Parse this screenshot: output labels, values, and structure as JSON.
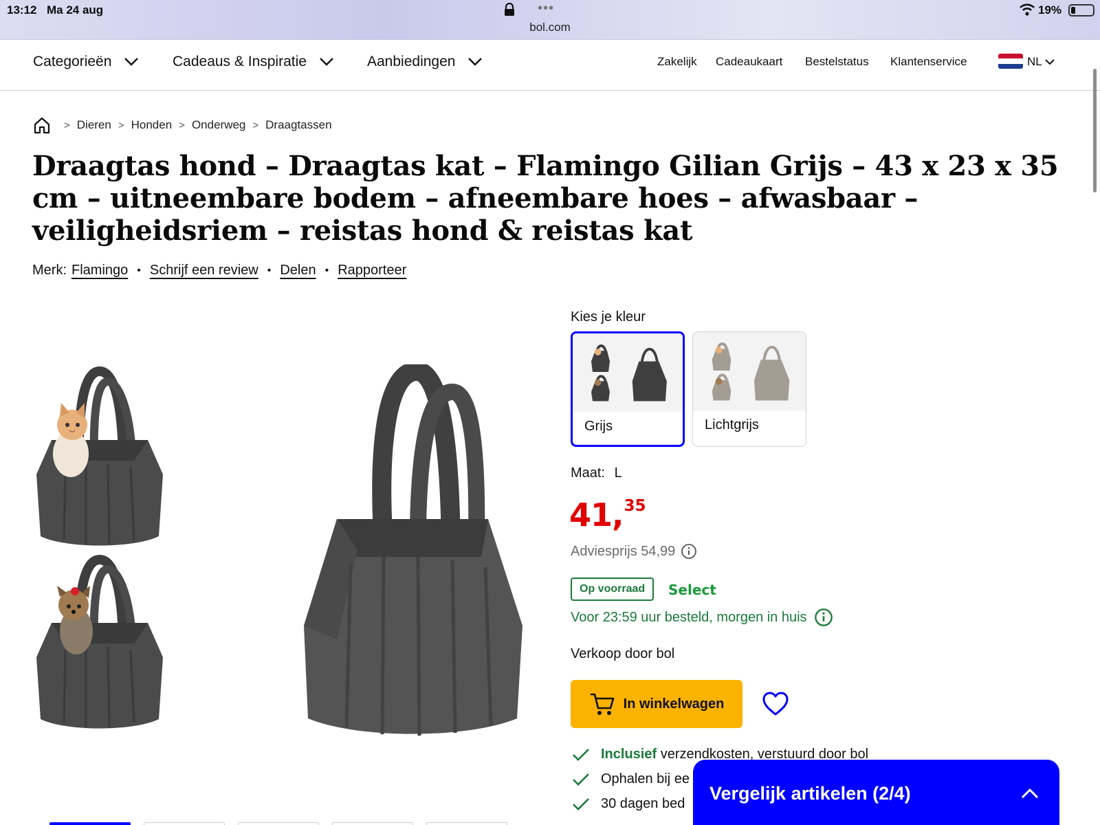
{
  "status_bar": {
    "time": "13:12",
    "date": "Ma 24 aug",
    "url": "bol.com",
    "menu_dots": "•••",
    "battery": "19%"
  },
  "nav": {
    "categories": "Categorieën",
    "gifts": "Cadeaus & Inspiratie",
    "deals": "Aanbiedingen",
    "business": "Zakelijk",
    "giftcard": "Cadeaukaart",
    "order_status": "Bestelstatus",
    "customer_service": "Klantenservice",
    "language": "NL"
  },
  "breadcrumb": [
    "Dieren",
    "Honden",
    "Onderweg",
    "Draagtassen"
  ],
  "product": {
    "title": "Draagtas hond – Draagtas kat – Flamingo Gilian Grijs – 43 x 23 x 35 cm – uitneembare bodem – afneembare hoes – afwasbaar – veiligheidsriem – reistas hond & reistas kat",
    "brand_label": "Merk:",
    "brand": "Flamingo",
    "write_review": "Schrijf een review",
    "share": "Delen",
    "report": "Rapporteer"
  },
  "color_picker": {
    "label": "Kies je kleur",
    "options": [
      {
        "label": "Grijs",
        "selected": true
      },
      {
        "label": "Lichtgrijs",
        "selected": false
      }
    ]
  },
  "size": {
    "label": "Maat:",
    "value": "L"
  },
  "price": {
    "whole": "41,",
    "cents": "35",
    "advice": "Adviesprijs 54,99",
    "color": "#e00000"
  },
  "availability": {
    "stock": "Op voorraad",
    "select": "Select",
    "delivery": "Voor 23:59 uur besteld, morgen in huis"
  },
  "seller": "Verkoop door bol",
  "cart_button": "In winkelwagen",
  "usps": [
    {
      "bold": "Inclusief",
      "text": " verzendkosten, verstuurd door bol"
    },
    {
      "bold": "",
      "text": "Ophalen bij ee"
    },
    {
      "bold": "",
      "text": "30 dagen bed"
    }
  ],
  "compare_panel": {
    "label": "Vergelijk artikelen (2/4)"
  },
  "colors": {
    "accent_blue": "#0000ff",
    "cta_yellow": "#fcb200",
    "success_green": "#1b7a3a"
  }
}
